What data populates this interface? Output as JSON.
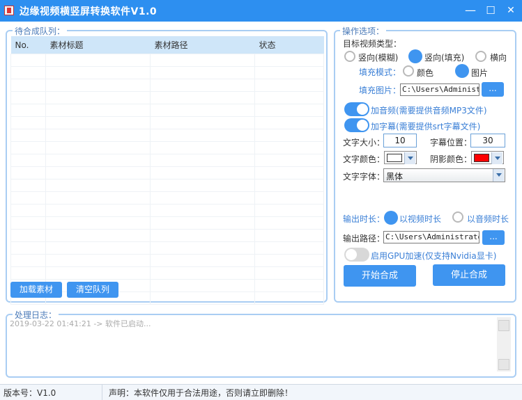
{
  "window": {
    "title": "边缘视频横竖屏转换软件V1.0",
    "minimize_glyph": "—",
    "maximize_glyph": "☐",
    "close_glyph": "✕"
  },
  "queue": {
    "group_label": "待合成队列：",
    "columns": [
      "No.",
      "素材标题",
      "素材路径",
      "状态"
    ],
    "load_button": "加载素材",
    "clear_button": "清空队列"
  },
  "options": {
    "group_label": "操作选项：",
    "target_type_label": "目标视频类型：",
    "target_types": [
      {
        "label": "竖向(模糊)",
        "selected": false
      },
      {
        "label": "竖向(填充)",
        "selected": true
      },
      {
        "label": "横向",
        "selected": false
      }
    ],
    "fill_mode_label": "填充模式：",
    "fill_modes": [
      {
        "label": "颜色",
        "selected": false
      },
      {
        "label": "图片",
        "selected": true
      }
    ],
    "fill_image_label": "填充图片：",
    "fill_image_value": "C:\\Users\\Administr",
    "browse_label": "...",
    "add_audio_label": "加音频(需要提供音频MP3文件)",
    "add_audio_on": true,
    "add_subtitle_label": "加字幕(需要提供srt字幕文件)",
    "add_subtitle_on": true,
    "font_size_label": "文字大小：",
    "font_size_value": "10",
    "subtitle_pos_label": "字幕位置：",
    "subtitle_pos_value": "30",
    "text_color_label": "文字颜色：",
    "text_color": "#ffffff",
    "shadow_color_label": "阴影颜色：",
    "shadow_color": "#ff0000",
    "font_label": "文字字体：",
    "font_value": "黑体",
    "output_duration_label": "输出时长：",
    "durations": [
      {
        "label": "以视频时长",
        "selected": true
      },
      {
        "label": "以音频时长",
        "selected": false
      }
    ],
    "output_path_label": "输出路径：",
    "output_path_value": "C:\\Users\\Administrator",
    "gpu_label": "启用GPU加速(仅支持Nvidia显卡)",
    "gpu_on": false,
    "start_button": "开始合成",
    "stop_button": "停止合成"
  },
  "log": {
    "group_label": "处理日志：",
    "entry": "2019-03-22 01:41:21 -> 软件已启动..."
  },
  "statusbar": {
    "version": "版本号：V1.0",
    "notice": "声明：本软件仅用于合法用途，否则请立即删除！"
  },
  "colors": {
    "accent": "#3f95f0",
    "titlebar": "#2d8ff0",
    "group_border": "#a9cdf3",
    "table_header": "#cfe6f9"
  }
}
